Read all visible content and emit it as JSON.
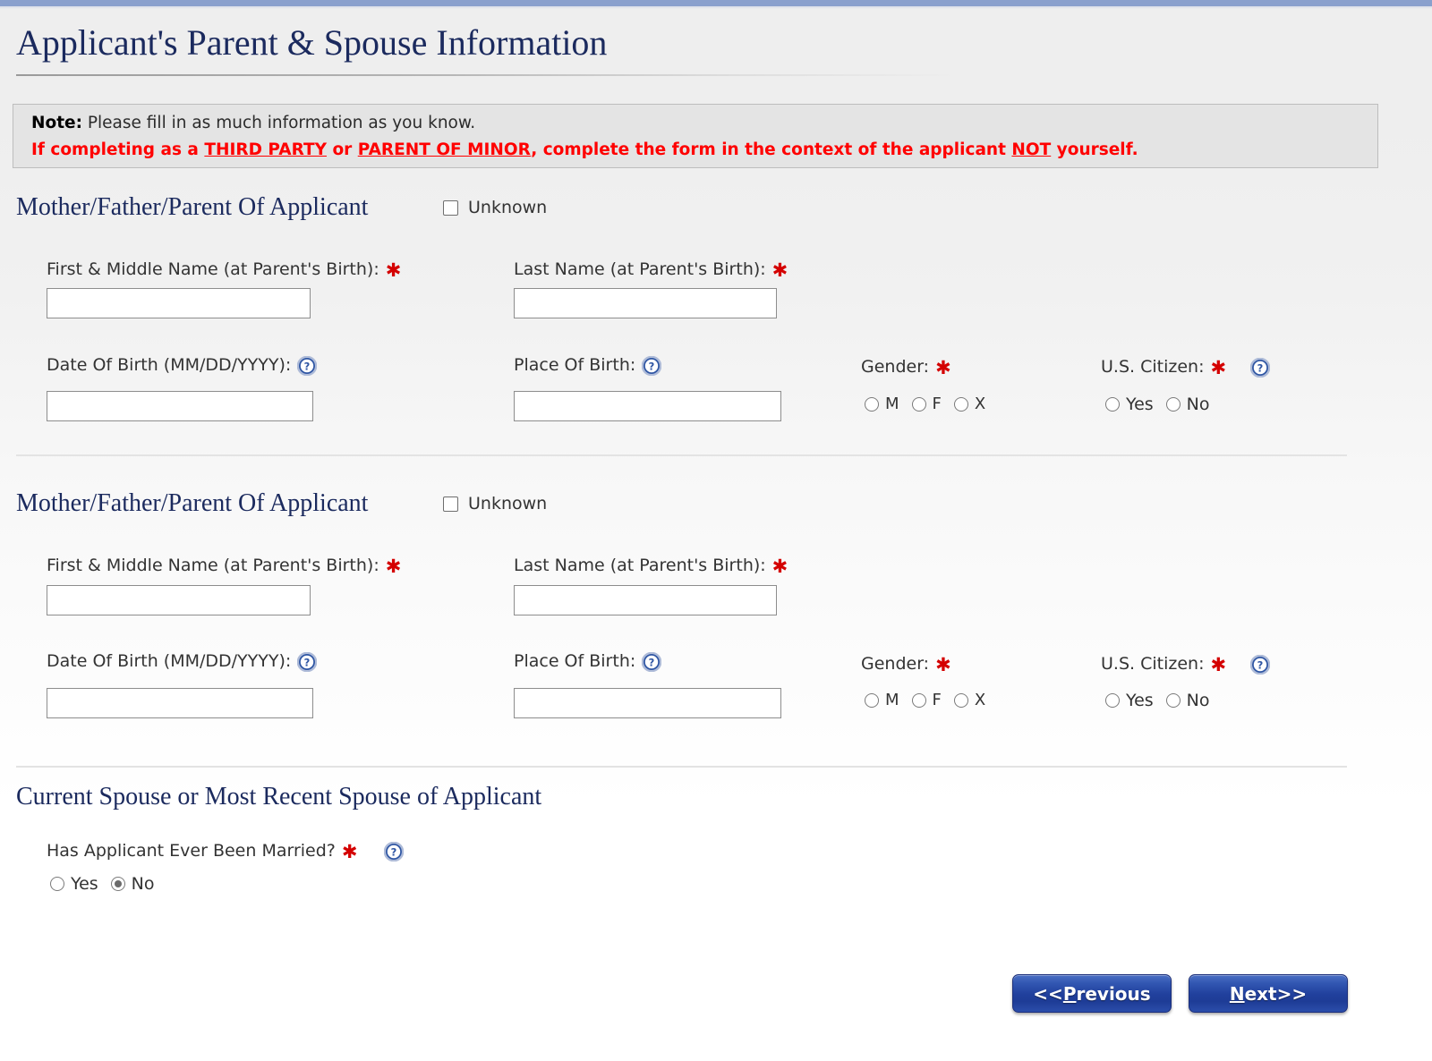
{
  "page": {
    "title": "Applicant's Parent & Spouse Information"
  },
  "note": {
    "label": "Note:",
    "line1_text": " Please fill in as much information as you know.",
    "line2_pre": "If completing as a ",
    "line2_link1": "THIRD PARTY",
    "line2_mid": " or ",
    "line2_link2": "PARENT OF MINOR",
    "line2_post": ", complete the form in the context of the applicant ",
    "line2_not": "NOT",
    "line2_end": " yourself."
  },
  "labels": {
    "unknown": "Unknown",
    "first_middle_name": "First & Middle Name (at Parent's Birth):",
    "last_name": "Last Name (at Parent's Birth):",
    "date_of_birth": "Date Of Birth (MM/DD/YYYY):",
    "place_of_birth": "Place Of Birth:",
    "gender": "Gender:",
    "us_citizen": "U.S. Citizen:",
    "ever_married": "Has Applicant Ever Been Married?",
    "required_star": "✱"
  },
  "parent1": {
    "heading": "Mother/Father/Parent Of Applicant",
    "unknown_checked": false,
    "first_middle_name_value": "",
    "last_name_value": "",
    "date_of_birth_value": "",
    "place_of_birth_value": "",
    "gender_options": [
      {
        "label": "M",
        "checked": false
      },
      {
        "label": "F",
        "checked": false
      },
      {
        "label": "X",
        "checked": false
      }
    ],
    "citizen_options": [
      {
        "label": "Yes",
        "checked": false
      },
      {
        "label": "No",
        "checked": false
      }
    ]
  },
  "parent2": {
    "heading": "Mother/Father/Parent Of Applicant",
    "unknown_checked": false,
    "first_middle_name_value": "",
    "last_name_value": "",
    "date_of_birth_value": "",
    "place_of_birth_value": "",
    "gender_options": [
      {
        "label": "M",
        "checked": false
      },
      {
        "label": "F",
        "checked": false
      },
      {
        "label": "X",
        "checked": false
      }
    ],
    "citizen_options": [
      {
        "label": "Yes",
        "checked": false
      },
      {
        "label": "No",
        "checked": false
      }
    ]
  },
  "spouse": {
    "heading": "Current Spouse or Most Recent Spouse of Applicant",
    "married_options": [
      {
        "label": "Yes",
        "checked": false
      },
      {
        "label": "No",
        "checked": true
      }
    ]
  },
  "footer": {
    "previous_prefix": "<< ",
    "previous_accel": "P",
    "previous_rest": "revious",
    "next_accel": "N",
    "next_rest": "ext",
    "next_suffix": " >>"
  },
  "colors": {
    "heading_navy": "#1b2a5e",
    "alert_red": "#ff0000",
    "required_red": "#d40000",
    "button_blue": "#21409d",
    "topbar_blue": "#8aa0cd",
    "note_bg": "#e4e4e4"
  }
}
